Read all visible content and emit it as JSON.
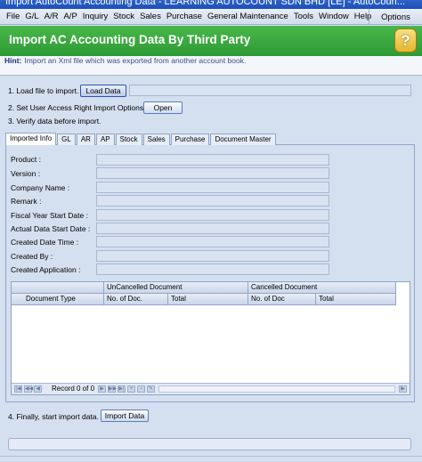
{
  "window": {
    "title": "Import AutoCount Accounting Data - LEARNING AUTOCOUNT SDN BHD [LE] - AutoCoun..."
  },
  "menu": {
    "items": [
      "File",
      "G/L",
      "A/R",
      "A/P",
      "Inquiry",
      "Stock",
      "Sales",
      "Purchase",
      "General Maintenance",
      "Tools",
      "Window",
      "Help"
    ],
    "options": "Options"
  },
  "header": {
    "title": "Import AC Accounting Data By Third Party",
    "help_glyph": "?"
  },
  "hint": {
    "label": "Hint:",
    "text": "Import an Xml file which was exported from another account book."
  },
  "steps": {
    "s1": "1. Load file to import.",
    "s1_button": "Load Data",
    "s2": "2. Set User Access Right Import Options.",
    "s2_button": "Open",
    "s3": "3. Verify data before import.",
    "s4": "4. Finally, start import data.",
    "s4_button": "Import Data"
  },
  "tabs": [
    "Imported Info",
    "GL",
    "AR",
    "AP",
    "Stock",
    "Sales",
    "Purchase",
    "Document Master"
  ],
  "fields": [
    "Product :",
    "Version :",
    "Company Name :",
    "Remark :",
    "Fiscal Year Start Date :",
    "Actual Data Start Date :",
    "Created Date Time :",
    "Created By :",
    "Created Application :"
  ],
  "grid": {
    "group_uncancelled": "UnCancelled Document",
    "group_cancelled": "Cancelled Document",
    "columns": [
      "Document Type",
      "No. of Doc.",
      "Total",
      "No. of Doc",
      "Total"
    ],
    "record_text": "Record 0 of 0"
  },
  "colors": {
    "header_green": "#2f9a35",
    "window_bg": "#d4dff0",
    "title_blue": "#1d4fb5"
  }
}
